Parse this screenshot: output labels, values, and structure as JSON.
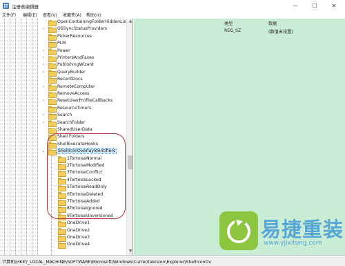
{
  "window": {
    "title": "注册表编辑器",
    "minimize": "—",
    "maximize": "☐",
    "close": "✕"
  },
  "menu": [
    "文件(F)",
    "编辑(E)",
    "查看(V)",
    "收藏夹(A)",
    "帮助(H)"
  ],
  "tree": {
    "items": [
      {
        "label": "OpenContainingFolderHiddenList",
        "expander": ""
      },
      {
        "label": "OSSyncStatusProviders",
        "expander": "›"
      },
      {
        "label": "PickerResources",
        "expander": ""
      },
      {
        "label": "PLM",
        "expander": ""
      },
      {
        "label": "Power",
        "expander": "›"
      },
      {
        "label": "PrintersAndFaxes",
        "expander": "›"
      },
      {
        "label": "PublishingWizard",
        "expander": "›"
      },
      {
        "label": "QueryBuilder",
        "expander": "›"
      },
      {
        "label": "RecentDocs",
        "expander": ""
      },
      {
        "label": "RemoteComputer",
        "expander": "›"
      },
      {
        "label": "RemoveAccess",
        "expander": ""
      },
      {
        "label": "ResetUserProfileCallbacks",
        "expander": "›"
      },
      {
        "label": "ResourceTimers",
        "expander": ""
      },
      {
        "label": "Search",
        "expander": "›"
      },
      {
        "label": "SearchFolder",
        "expander": "›"
      },
      {
        "label": "SharedUserData",
        "expander": ""
      },
      {
        "label": "Shell Folders",
        "expander": ""
      },
      {
        "label": "ShellExecuteHooks",
        "expander": ""
      },
      {
        "label": "ShellIconOverlayIdentifiers",
        "expander": "⌄"
      }
    ],
    "children": [
      "1TortoiseNormal",
      "2TortoiseModified",
      "3TortoiseConflict",
      "4TortoiseLocked",
      "5TortoiseReadOnly",
      "6TortoiseDeleted",
      "7TortoiseAdded",
      "8TortoiseIgnored",
      "9TortoiseUnversioned",
      "OneDrive1",
      "OneDrive2",
      "OneDrive3",
      "OneDrive4"
    ],
    "scroll_up": "▲",
    "scroll_down": "▼"
  },
  "values": {
    "headers": {
      "type": "类型",
      "data": "数据"
    },
    "rows": [
      {
        "type": "REG_SZ",
        "data": "(数值未设置)"
      }
    ]
  },
  "status": "计算机\\HKEY_LOCAL_MACHINE\\SOFTWARE\\Microsoft\\Windows\\CurrentVersion\\Explorer\\ShellIconOv",
  "watermark": {
    "brand": "易捷重装",
    "url": "www.yjixitong.com"
  },
  "colors": {
    "values_bg": "#c9ecd4",
    "selection": "#cce8ff",
    "ellipse": "#b03030",
    "watermark_green": "#8cc63f",
    "watermark_blue": "#57a6d8"
  }
}
